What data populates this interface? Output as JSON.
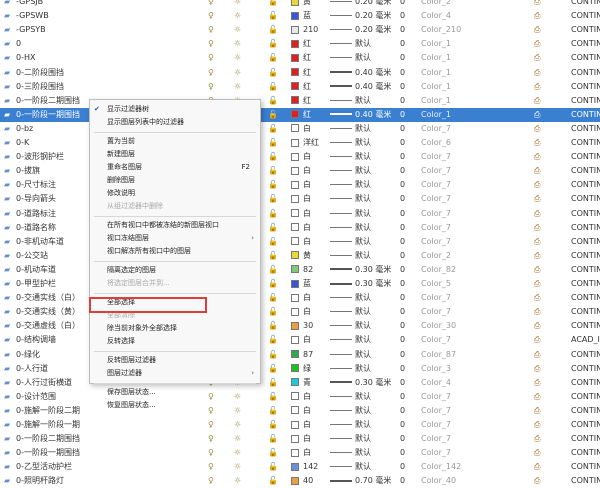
{
  "layers": [
    {
      "name": "-GPSJB",
      "color": "#e8d838",
      "cname": "黄",
      "line": "thin",
      "lw": "0.20 毫米",
      "trans": "0",
      "pstyle": "Color_2",
      "desc": "CONTIN"
    },
    {
      "name": "-GPSWB",
      "color": "#3a55d8",
      "cname": "蓝",
      "line": "thin",
      "lw": "0.20 毫米",
      "trans": "0",
      "pstyle": "Color_4",
      "desc": "CONTIN"
    },
    {
      "name": "-GPSYB",
      "color": "#e8e8e8",
      "cname": "210",
      "line": "thin",
      "lw": "0.20 毫米",
      "trans": "0",
      "pstyle": "Color_210",
      "desc": "CONTIN"
    },
    {
      "name": "0",
      "color": "#e02020",
      "cname": "红",
      "line": "thin",
      "lw": "默认",
      "trans": "0",
      "pstyle": "Color_1",
      "desc": "CONTIN"
    },
    {
      "name": "0-HX",
      "color": "#e02020",
      "cname": "红",
      "line": "thin",
      "lw": "默认",
      "trans": "0",
      "pstyle": "Color_1",
      "desc": "CONTIN"
    },
    {
      "name": "0-二阶段围挡",
      "color": "#e02020",
      "cname": "红",
      "line": "thick",
      "lw": "0.40 毫米",
      "trans": "0",
      "pstyle": "Color_1",
      "desc": "CONTIN"
    },
    {
      "name": "0-三阶段围挡",
      "color": "#e02020",
      "cname": "红",
      "line": "thick",
      "lw": "0.40 毫米",
      "trans": "0",
      "pstyle": "Color_1",
      "desc": "CONTIN"
    },
    {
      "name": "0-一阶段二期围挡",
      "color": "#e02020",
      "cname": "红",
      "line": "thin",
      "lw": "默认",
      "trans": "0",
      "pstyle": "Color_1",
      "desc": "CONTIN"
    },
    {
      "name": "0-一阶段一期围挡",
      "color": "#e02020",
      "cname": "红",
      "line": "thick",
      "lw": "0.40 毫米",
      "trans": "0",
      "pstyle": "Color_1",
      "desc": "CONTIN",
      "selected": true
    },
    {
      "name": "0-bz",
      "color": "#ffffff",
      "cname": "白",
      "line": "thin",
      "lw": "默认",
      "trans": "0",
      "pstyle": "Color_7",
      "desc": "CONTIN"
    },
    {
      "name": "0-K",
      "color": "#ffffff",
      "cname": "洋红",
      "line": "thin",
      "lw": "默认",
      "trans": "0",
      "pstyle": "Color_6",
      "desc": "CONTIN"
    },
    {
      "name": "0-波形钢护栏",
      "color": "#ffffff",
      "cname": "白",
      "line": "thin",
      "lw": "默认",
      "trans": "0",
      "pstyle": "Color_7",
      "desc": "CONTIN"
    },
    {
      "name": "0-拔旗",
      "color": "#ffffff",
      "cname": "白",
      "line": "thin",
      "lw": "默认",
      "trans": "0",
      "pstyle": "Color_7",
      "desc": "CONTIN"
    },
    {
      "name": "0-尺寸标注",
      "color": "#ffffff",
      "cname": "白",
      "line": "thin",
      "lw": "默认",
      "trans": "0",
      "pstyle": "Color_7",
      "desc": "CONTIN"
    },
    {
      "name": "0-导向箭头",
      "color": "#ffffff",
      "cname": "白",
      "line": "thin",
      "lw": "默认",
      "trans": "0",
      "pstyle": "Color_7",
      "desc": "CONTIN"
    },
    {
      "name": "0-道路标注",
      "color": "#ffffff",
      "cname": "白",
      "line": "thin",
      "lw": "默认",
      "trans": "0",
      "pstyle": "Color_7",
      "desc": "CONTIN"
    },
    {
      "name": "0-道路名称",
      "color": "#ffffff",
      "cname": "白",
      "line": "thin",
      "lw": "默认",
      "trans": "0",
      "pstyle": "Color_7",
      "desc": "CONTIN"
    },
    {
      "name": "0-非机动车道",
      "color": "#ffffff",
      "cname": "白",
      "line": "thin",
      "lw": "默认",
      "trans": "0",
      "pstyle": "Color_7",
      "desc": "CONTIN"
    },
    {
      "name": "0-公交站",
      "color": "#e8d838",
      "cname": "黄",
      "line": "thin",
      "lw": "默认",
      "trans": "0",
      "pstyle": "Color_2",
      "desc": "CONTIN"
    },
    {
      "name": "0-机动车道",
      "color": "#7fc97f",
      "cname": "82",
      "line": "thick",
      "lw": "0.30 毫米",
      "trans": "0",
      "pstyle": "Color_82",
      "desc": "CONTIN"
    },
    {
      "name": "0-甲型护栏",
      "color": "#3a55d8",
      "cname": "蓝",
      "line": "thick",
      "lw": "0.30 毫米",
      "trans": "0",
      "pstyle": "Color_5",
      "desc": "CONTIN"
    },
    {
      "name": "0-交通实线（白）",
      "color": "#ffffff",
      "cname": "白",
      "line": "thin",
      "lw": "默认",
      "trans": "0",
      "pstyle": "Color_7",
      "desc": "CONTIN"
    },
    {
      "name": "0-交通实线（黄）",
      "color": "#ffffff",
      "cname": "白",
      "line": "thin",
      "lw": "默认",
      "trans": "0",
      "pstyle": "Color_7",
      "desc": "CONTIN"
    },
    {
      "name": "0-交通虚线（白）",
      "color": "#e8a040",
      "cname": "30",
      "line": "thin",
      "lw": "默认",
      "trans": "0",
      "pstyle": "Color_30",
      "desc": "CONTIN"
    },
    {
      "name": "0-结构调墙",
      "color": "#ffffff",
      "cname": "白",
      "line": "thin",
      "lw": "默认",
      "trans": "0",
      "pstyle": "Color_7",
      "desc": "ACAD_IS"
    },
    {
      "name": "0-绿化",
      "color": "#2fa84f",
      "cname": "87",
      "line": "thin",
      "lw": "默认",
      "trans": "0",
      "pstyle": "Color_87",
      "desc": "CONTIN"
    },
    {
      "name": "0-人行道",
      "color": "#20c020",
      "cname": "绿",
      "line": "thin",
      "lw": "默认",
      "trans": "0",
      "pstyle": "Color_3",
      "desc": "CONTIN"
    },
    {
      "name": "0-人行过街横道",
      "color": "#20c8d8",
      "cname": "青",
      "line": "thick",
      "lw": "0.30 毫米",
      "trans": "0",
      "pstyle": "Color_4",
      "desc": "CONTIN"
    },
    {
      "name": "0-设计范围",
      "color": "#ffffff",
      "cname": "白",
      "line": "thin",
      "lw": "默认",
      "trans": "0",
      "pstyle": "Color_7",
      "desc": "CONTIN"
    },
    {
      "name": "0-施解一阶段二期",
      "color": "#ffffff",
      "cname": "白",
      "line": "thin",
      "lw": "默认",
      "trans": "0",
      "pstyle": "Color_7",
      "desc": "CONTIN"
    },
    {
      "name": "0-施解一阶段一期",
      "color": "#ffffff",
      "cname": "白",
      "line": "thin",
      "lw": "默认",
      "trans": "0",
      "pstyle": "Color_7",
      "desc": "CONTIN"
    },
    {
      "name": "0-一阶段二期围挡",
      "color": "#ffffff",
      "cname": "白",
      "line": "thin",
      "lw": "默认",
      "trans": "0",
      "pstyle": "Color_7",
      "desc": "CONTIN"
    },
    {
      "name": "0-一阶段一期围挡",
      "color": "#ffffff",
      "cname": "白",
      "line": "thin",
      "lw": "默认",
      "trans": "0",
      "pstyle": "Color_7",
      "desc": "CONTIN"
    },
    {
      "name": "0-乙型活动护栏",
      "color": "#6a90d8",
      "cname": "142",
      "line": "thin",
      "lw": "默认",
      "trans": "0",
      "pstyle": "Color_142",
      "desc": "CONTIN"
    },
    {
      "name": "0-照明杆路灯",
      "color": "#e8a040",
      "cname": "40",
      "line": "thick",
      "lw": "0.70 毫米",
      "trans": "0",
      "pstyle": "Color_40",
      "desc": "CONTIN"
    }
  ],
  "menu": {
    "items": [
      {
        "label": "显示过滤器树",
        "checked": true
      },
      {
        "label": "显示图层列表中的过滤器"
      },
      {
        "sep": true
      },
      {
        "label": "置为当前"
      },
      {
        "label": "新建图层"
      },
      {
        "label": "重命名图层",
        "shortcut": "F2"
      },
      {
        "label": "删除图层"
      },
      {
        "label": "修改说明"
      },
      {
        "label": "从组过滤器中删除",
        "disabled": true
      },
      {
        "sep": true
      },
      {
        "label": "在所有视口中都被冻结的新图层视口"
      },
      {
        "label": "视口冻结图层",
        "submenu": true
      },
      {
        "label": "视口解冻所有视口中的图层"
      },
      {
        "sep": true
      },
      {
        "label": "隔离选定的图层"
      },
      {
        "label": "将选定图层合并到...",
        "disabled": true
      },
      {
        "sep": true
      },
      {
        "label": "全部选择"
      },
      {
        "label": "全部清除",
        "disabled": true
      },
      {
        "label": "除当前对象外全部选择",
        "highlighted": true
      },
      {
        "label": "反转选择"
      },
      {
        "sep": true
      },
      {
        "label": "反转图层过滤器"
      },
      {
        "label": "图层过滤器",
        "submenu": true
      },
      {
        "sep": true
      },
      {
        "label": "保存图层状态..."
      },
      {
        "label": "恢复图层状态..."
      }
    ]
  },
  "icons": {
    "layer": "layer-stack-icon",
    "on": "lightbulb-icon",
    "freeze": "sun-icon",
    "lock": "padlock-icon",
    "plot": "printer-icon"
  },
  "colors": {
    "selection": "#3b7fd1",
    "highlight_box": "#e03c3c"
  }
}
